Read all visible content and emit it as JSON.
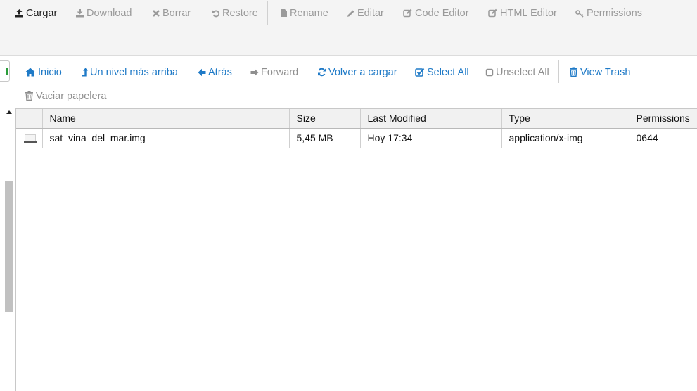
{
  "toolbar": {
    "upload": "Cargar",
    "download": "Download",
    "delete": "Borrar",
    "restore": "Restore",
    "rename": "Rename",
    "edit": "Editar",
    "code_editor": "Code Editor",
    "html_editor": "HTML Editor",
    "permissions": "Permissions"
  },
  "nav": {
    "home": "Inicio",
    "up_one_level": "Un nivel más arriba",
    "back": "Atrás",
    "forward": "Forward",
    "reload": "Volver a cargar",
    "select_all": "Select All",
    "unselect_all": "Unselect All",
    "view_trash": "View Trash",
    "empty_trash": "Vaciar papelera"
  },
  "colors": {
    "link": "#1f7ac7",
    "disabled": "#9a9a9a",
    "toolbar_bg": "#f4f4f4"
  },
  "file_table": {
    "columns": [
      "Name",
      "Size",
      "Last Modified",
      "Type",
      "Permissions"
    ],
    "rows": [
      {
        "icon": "disk-image-icon",
        "name": "sat_vina_del_mar.img",
        "size": "5,45 MB",
        "modified": "Hoy 17:34",
        "type": "application/x-img",
        "permissions": "0644"
      }
    ]
  }
}
